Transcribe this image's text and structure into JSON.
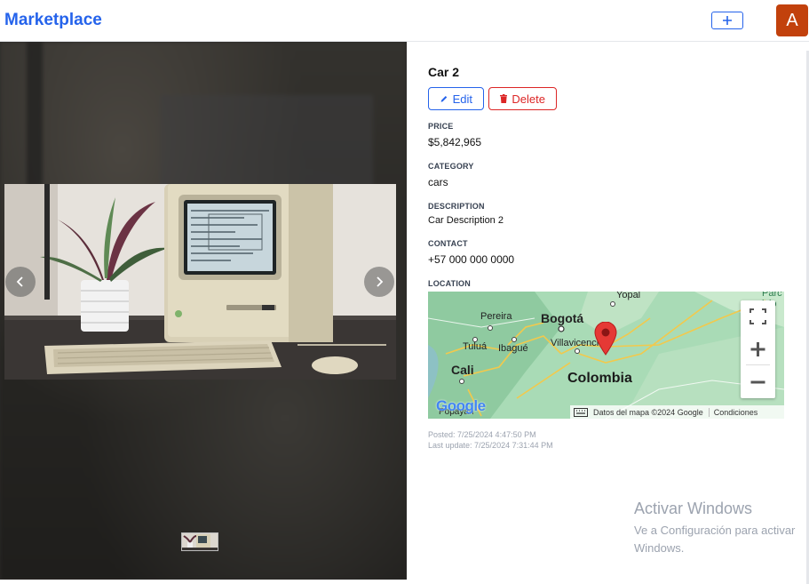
{
  "header": {
    "brand": "Marketplace",
    "add_icon": "plus-icon",
    "avatar_initial": "A",
    "brand_color": "#2563eb",
    "avatar_color": "#c2410c"
  },
  "listing": {
    "title": "Car 2",
    "edit_label": "Edit",
    "delete_label": "Delete",
    "price_label": "PRICE",
    "price": "$5,842,965",
    "category_label": "CATEGORY",
    "category": "cars",
    "description_label": "DESCRIPTION",
    "description": "Car Description 2",
    "contact_label": "CONTACT",
    "contact": "+57 000 000 0000",
    "location_label": "LOCATION",
    "posted": "Posted: 7/25/2024 4:47:50 PM",
    "updated": "Last update: 7/25/2024 7:31:44 PM"
  },
  "map": {
    "labels": {
      "yopal": "Yopal",
      "pereira": "Pereira",
      "bogota": "Bogotá",
      "villavicencio": "Villavicencio",
      "tulua": "Tuluá",
      "ibague": "Ibagué",
      "cali": "Cali",
      "colombia": "Colombia",
      "popayan": "Popayán",
      "edge_right": "Parc\nicio\n\npa"
    },
    "logo": "Google",
    "attribution": "Datos del mapa ©2024 Google",
    "terms": "Condiciones",
    "marker_color": "#e53935"
  },
  "watermark": {
    "title": "Activar Windows",
    "subtitle": "Ve a Configuración para activar Windows."
  }
}
